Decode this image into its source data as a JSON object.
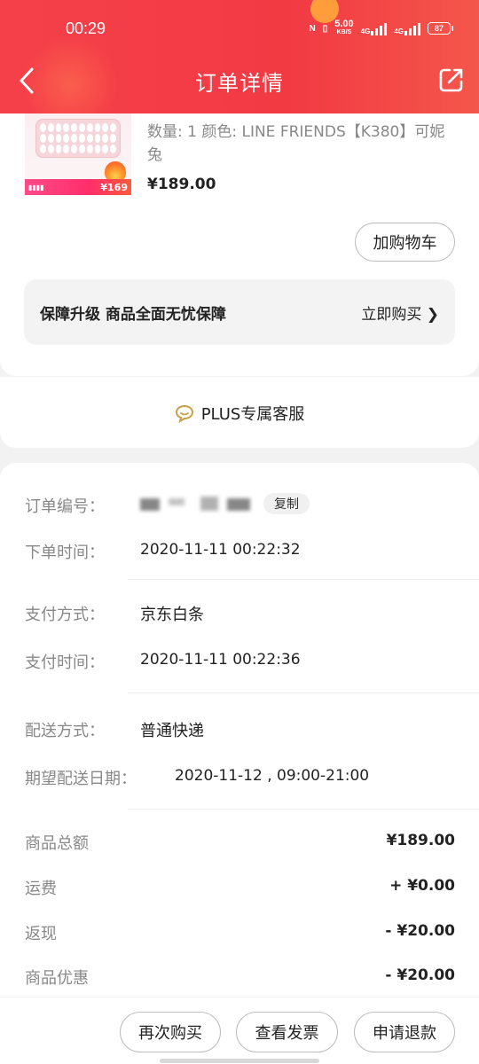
{
  "status_bar": {
    "time": "00:29",
    "netspeed_value": "5.00",
    "netspeed_unit": "KB/S",
    "sim1": "4G",
    "sim2": "4G",
    "battery": "87"
  },
  "header": {
    "title": "订单详情",
    "back_icon": "chevron-left-icon",
    "share_icon": "share-icon"
  },
  "product": {
    "spec": "数量: 1  颜色: LINE FRIENDS【K380】可妮兔",
    "price": "¥189.00",
    "promo_price": "¥169",
    "add_cart_label": "加购物车"
  },
  "guarantee": {
    "label": "保障升级  商品全面无忧保障",
    "link": "立即购买 ❯"
  },
  "service": {
    "label": "PLUS专属客服",
    "icon": "chat-bubble-icon"
  },
  "order": {
    "number_label": "订单编号：",
    "copy_label": "复制",
    "order_time_label": "下单时间：",
    "order_time": "2020-11-11 00:22:32",
    "pay_method_label": "支付方式：",
    "pay_method": "京东白条",
    "pay_time_label": "支付时间：",
    "pay_time": "2020-11-11 00:22:36",
    "delivery_label": "配送方式：",
    "delivery": "普通快递",
    "expect_label": "期望配送日期：",
    "expect": "2020-11-12 , 09:00-21:00"
  },
  "amounts": {
    "goods_total_label": "商品总额",
    "goods_total": "¥189.00",
    "freight_label": "运费",
    "freight": "+ ¥0.00",
    "cashback_label": "返现",
    "cashback": "- ¥20.00",
    "discount_label": "商品优惠",
    "discount": "- ¥20.00"
  },
  "actions": {
    "rebuy": "再次购买",
    "invoice": "查看发票",
    "refund": "申请退款"
  },
  "colors": {
    "header_red": "#f23a43",
    "accent_orange": "#ffa23c",
    "text_gray": "#888888"
  }
}
